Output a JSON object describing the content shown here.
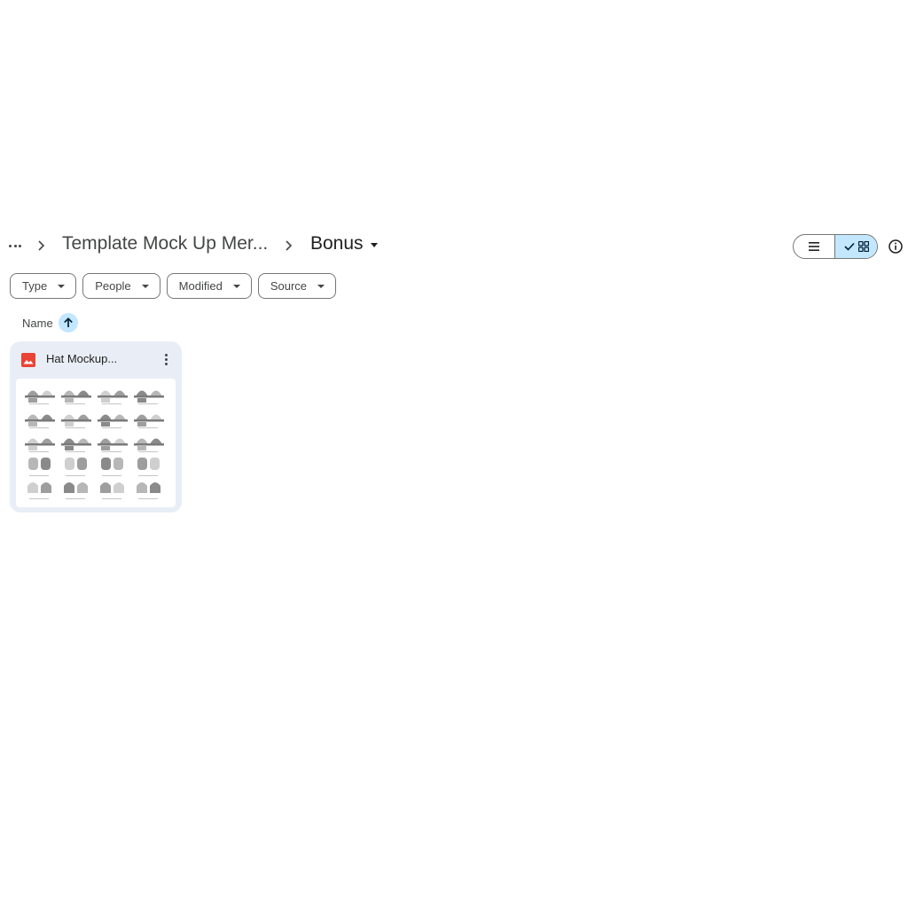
{
  "breadcrumb": {
    "more_icon": "more-horiz-icon",
    "parent": "Template Mock Up Mer...",
    "current": "Bonus"
  },
  "view": {
    "list_icon": "list-view-icon",
    "grid_icon": "grid-view-icon",
    "selected": "grid",
    "info_icon": "info-icon"
  },
  "filters": {
    "type": "Type",
    "people": "People",
    "modified": "Modified",
    "source": "Source"
  },
  "sort": {
    "label": "Name",
    "direction_icon": "arrow-upward-icon"
  },
  "files": [
    {
      "name": "Hat Mockup...",
      "type_icon": "image-file-icon",
      "icon_color": "#ea4335"
    }
  ],
  "colors": {
    "accent": "#c2e7ff",
    "card_bg": "#e9eef6",
    "border": "#747775",
    "text": "#1f1f1f"
  }
}
